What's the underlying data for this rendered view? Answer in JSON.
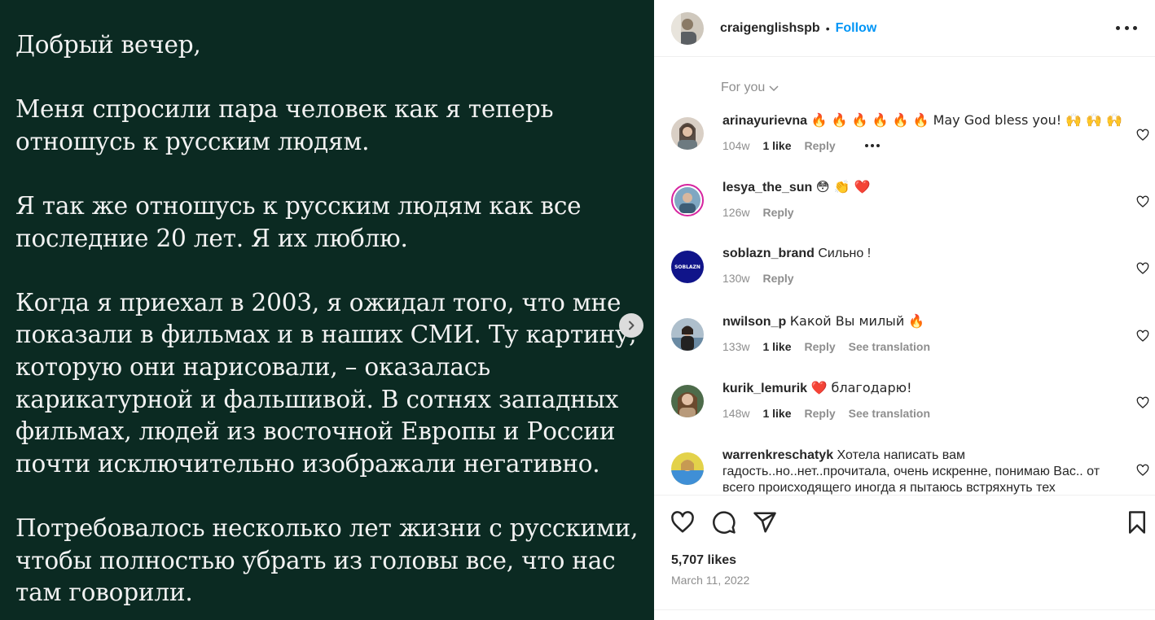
{
  "post": {
    "paragraphs": [
      "Добрый вечер,",
      "Меня спросили пара человек как я теперь\nотношусь к русским людям.",
      "Я так же отношусь к русским людям как все\nпоследние 20 лет. Я их люблю.",
      "Когда я приехал в 2003, я ожидал того, что мне\nпоказали в фильмах и в наших СМИ. Ту картину,\nкоторую они нарисовали, – оказалась\nкарикатурной и фальшивой. В сотнях западных\nфильмах, людей из восточной Европы и России\nпочти исключительно изображали негативно.",
      "Потребовалось несколько лет жизни с русскими,\nчтобы полностью убрать из головы все, что нас\nтам говорили."
    ],
    "background_color": "#0b2a22"
  },
  "header": {
    "username": "craigenglishspb",
    "separator": "•",
    "follow_label": "Follow"
  },
  "sort": {
    "label": "For you"
  },
  "comments": [
    {
      "username": "arinayurievna",
      "text": "🔥 🔥 🔥 🔥 🔥 🔥 May God bless you! 🙌 🙌 🙌",
      "age": "104w",
      "likes": "1 like",
      "reply": "Reply",
      "translation": ""
    },
    {
      "username": "lesya_the_sun",
      "text": "😳 👏 ❤️",
      "age": "126w",
      "likes": "",
      "reply": "Reply",
      "translation": ""
    },
    {
      "username": "soblazn_brand",
      "text": "Сильно !",
      "age": "130w",
      "likes": "",
      "reply": "Reply",
      "translation": "",
      "avatar_text": "SOBLAZN"
    },
    {
      "username": "nwilson_p",
      "text": "Какой Вы милый 🔥",
      "age": "133w",
      "likes": "1 like",
      "reply": "Reply",
      "translation": "See translation"
    },
    {
      "username": "kurik_lemurik",
      "text": "❤️ благодарю!",
      "age": "148w",
      "likes": "1 like",
      "reply": "Reply",
      "translation": "See translation"
    },
    {
      "username": "warrenkreschatyk",
      "text": "Хотела написать вам гадость..но..нет..прочитала, очень искренне, понимаю Вас.. от всего происходящего иногда я пытаюсь  встряхнуть тех",
      "age": "",
      "likes": "",
      "reply": "",
      "translation": ""
    }
  ],
  "footer": {
    "likes": "5,707 likes",
    "date": "March 11, 2022"
  },
  "icons": {
    "next": "chevron-right-icon",
    "like": "heart-icon",
    "comment": "comment-icon",
    "share": "paper-plane-icon",
    "save": "bookmark-icon"
  },
  "colors": {
    "accent": "#0095f6",
    "text": "#262626",
    "muted": "#8e8e8e"
  }
}
